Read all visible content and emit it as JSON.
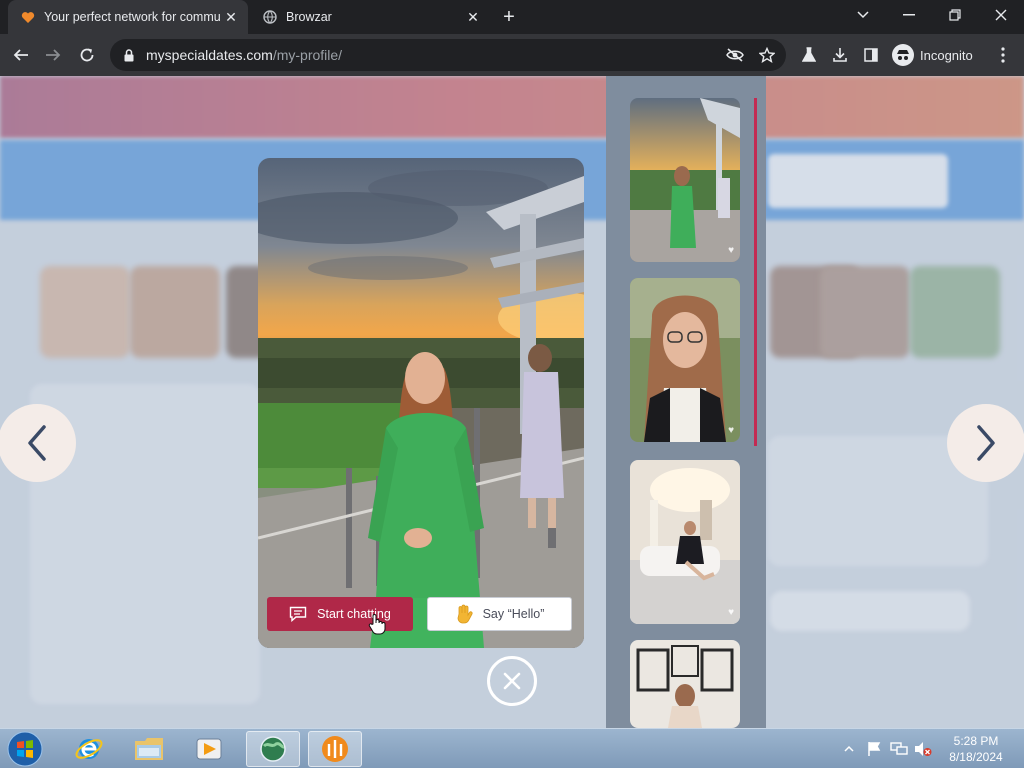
{
  "browser": {
    "tabs": [
      {
        "title": "Your perfect network for commu",
        "active": true,
        "icon": "heart-favicon"
      },
      {
        "title": "Browzar",
        "active": false,
        "icon": "globe-favicon"
      }
    ],
    "url_domain": "myspecialdates.com",
    "url_path": "/my-profile/",
    "incognito_label": "Incognito"
  },
  "modal": {
    "start_chatting_label": "Start chatting",
    "say_hello_label": "Say “Hello”"
  },
  "taskbar": {
    "time": "5:28 PM",
    "date": "8/18/2024"
  },
  "colors": {
    "brand": "#b02848",
    "header_start": "#9b3b63",
    "header_end": "#d96d44",
    "banner": "#3d87d7"
  }
}
